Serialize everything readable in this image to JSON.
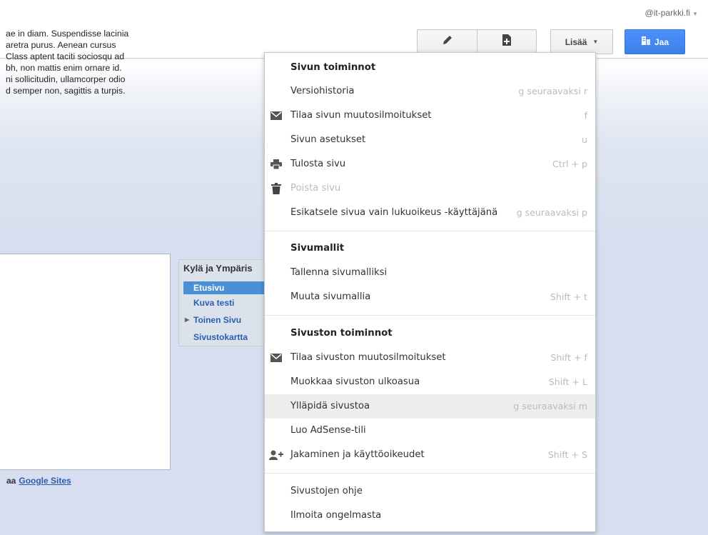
{
  "account": {
    "email": "@it-parkki.fi"
  },
  "toolbar": {
    "edit_icon": "pencil-icon",
    "new_page_icon": "new-page-icon",
    "more_label": "Lisää",
    "share_label": "Jaa",
    "share_icon": "share-icon"
  },
  "content": {
    "lines": [
      "ae in diam. Suspendisse lacinia",
      "aretra purus. Aenean cursus",
      "Class aptent taciti sociosqu ad",
      "bh, non mattis enim ornare id.",
      "ni sollicitudin, ullamcorper odio",
      "d semper non, sagittis a turpis."
    ],
    "footer_prefix": "aa",
    "footer_link": "Google Sites"
  },
  "nav": {
    "title": "Kylä ja Ympäris",
    "items": [
      {
        "label": "Etusivu",
        "active": true
      },
      {
        "label": "Kuva testi",
        "active": false
      },
      {
        "label": "Toinen Sivu",
        "active": false,
        "expandable": true
      },
      {
        "label": "Sivustokartta",
        "active": false
      }
    ]
  },
  "menu": {
    "sections": [
      {
        "header": "Sivun toiminnot",
        "items": [
          {
            "label": "Versiohistoria",
            "shortcut": "g seuraavaksi r",
            "icon": ""
          },
          {
            "label": "Tilaa sivun muutosilmoitukset",
            "shortcut": "f",
            "icon": "mail-icon"
          },
          {
            "label": "Sivun asetukset",
            "shortcut": "u",
            "icon": ""
          },
          {
            "label": "Tulosta sivu",
            "shortcut": "Ctrl + p",
            "icon": "print-icon"
          },
          {
            "label": "Poista sivu",
            "shortcut": "",
            "icon": "trash-icon",
            "disabled": true
          },
          {
            "label": "Esikatsele sivua vain lukuoikeus -käyttäjänä",
            "shortcut": "g seuraavaksi p",
            "icon": ""
          }
        ]
      },
      {
        "header": "Sivumallit",
        "items": [
          {
            "label": "Tallenna sivumalliksi",
            "shortcut": "",
            "icon": ""
          },
          {
            "label": "Muuta sivumallia",
            "shortcut": "Shift + t",
            "icon": ""
          }
        ]
      },
      {
        "header": "Sivuston toiminnot",
        "items": [
          {
            "label": "Tilaa sivuston muutosilmoitukset",
            "shortcut": "Shift + f",
            "icon": "mail-icon"
          },
          {
            "label": "Muokkaa sivuston ulkoasua",
            "shortcut": "Shift + L",
            "icon": ""
          },
          {
            "label": "Ylläpidä sivustoa",
            "shortcut": "g seuraavaksi m",
            "icon": "",
            "hover": true
          },
          {
            "label": "Luo AdSense-tili",
            "shortcut": "",
            "icon": ""
          },
          {
            "label": "Jakaminen ja käyttöoikeudet",
            "shortcut": "Shift + S",
            "icon": "add-person-icon"
          }
        ]
      },
      {
        "header": "",
        "items": [
          {
            "label": "Sivustojen ohje",
            "shortcut": "",
            "icon": ""
          },
          {
            "label": "Ilmoita ongelmasta",
            "shortcut": "",
            "icon": ""
          }
        ]
      }
    ]
  }
}
